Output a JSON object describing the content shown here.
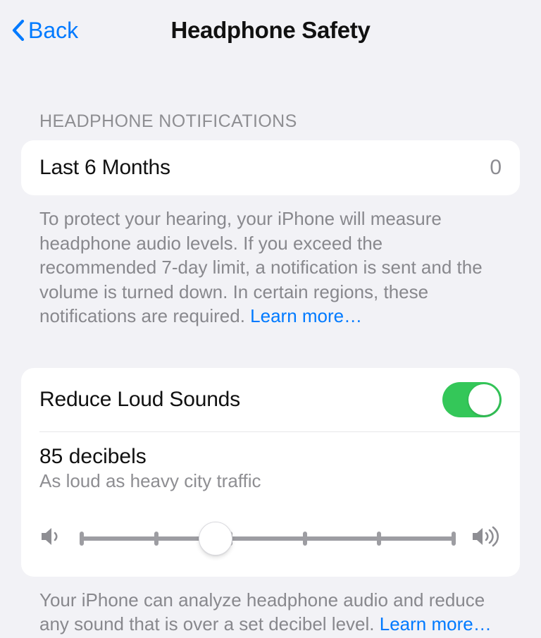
{
  "nav": {
    "back": "Back",
    "title": "Headphone Safety"
  },
  "notifications": {
    "header": "HEADPHONE NOTIFICATIONS",
    "row_label": "Last 6 Months",
    "row_value": "0",
    "footer": "To protect your hearing, your iPhone will measure headphone audio levels. If you exceed the recommended 7-day limit, a notification is sent and the volume is turned down. In certain regions, these notifications are required. ",
    "learn_more": "Learn more…"
  },
  "reduce": {
    "toggle_label": "Reduce Loud Sounds",
    "toggle_on": true,
    "decibel_title": "85 decibels",
    "decibel_sub": "As loud as heavy city traffic",
    "slider_value_percent": 36,
    "footer": "Your iPhone can analyze headphone audio and reduce any sound that is over a set decibel level. ",
    "learn_more": "Learn more…"
  }
}
